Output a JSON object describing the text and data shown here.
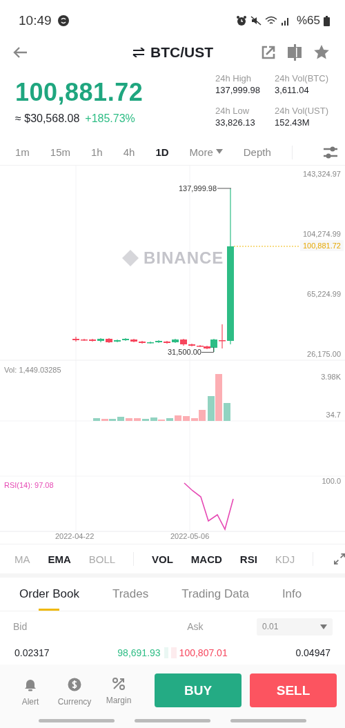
{
  "status_bar": {
    "time": "10:49",
    "battery": "%65"
  },
  "header": {
    "title": "BTC/UST"
  },
  "price": {
    "last": "100,881.72",
    "fiat": "≈ $30,568.08",
    "change": "+185.73%"
  },
  "stats": [
    {
      "label": "24h High",
      "value": "137,999.98"
    },
    {
      "label": "24h Vol(BTC)",
      "value": "3,611.04"
    },
    {
      "label": "24h Low",
      "value": "33,826.13"
    },
    {
      "label": "24h Vol(UST)",
      "value": "152.43M"
    }
  ],
  "intervals": [
    {
      "label": "1m",
      "selected": false
    },
    {
      "label": "15m",
      "selected": false
    },
    {
      "label": "1h",
      "selected": false
    },
    {
      "label": "4h",
      "selected": false
    },
    {
      "label": "1D",
      "selected": true
    },
    {
      "label": "More",
      "selected": false,
      "kind": "menu"
    },
    {
      "label": "Depth",
      "selected": false
    }
  ],
  "chart": {
    "watermark": "BINANCE",
    "high_marker": "137,999.98",
    "low_marker": "31,500.00",
    "current_price": "100,881.72",
    "y_labels": [
      "143,324.97",
      "104,274.99",
      "65,224.99",
      "26,175.00"
    ]
  },
  "volume": {
    "label": "Vol: 1,449.03285",
    "y_labels": [
      "3.98K",
      "34.7"
    ]
  },
  "rsi": {
    "label": "RSI(14): 97.08",
    "y_label": "100.0"
  },
  "dates": [
    "2022-04-22",
    "2022-05-06"
  ],
  "indicator_groups": [
    [
      {
        "label": "MA",
        "on": false
      },
      {
        "label": "EMA",
        "on": true
      },
      {
        "label": "BOLL",
        "on": false
      }
    ],
    [
      {
        "label": "VOL",
        "on": true
      },
      {
        "label": "MACD",
        "on": true
      },
      {
        "label": "RSI",
        "on": true
      },
      {
        "label": "KDJ",
        "on": false
      }
    ]
  ],
  "tabs": [
    {
      "label": "Order Book",
      "selected": true
    },
    {
      "label": "Trades",
      "selected": false
    },
    {
      "label": "Trading Data",
      "selected": false
    },
    {
      "label": "Info",
      "selected": false
    }
  ],
  "order_book": {
    "bid_label": "Bid",
    "ask_label": "Ask",
    "precision": "0.01",
    "rows": [
      {
        "bid_amount": "0.02317",
        "bid_price": "98,691.93",
        "ask_price": "100,807.01",
        "ask_amount": "0.04947"
      }
    ]
  },
  "actions": [
    {
      "label": "Alert",
      "kind": "bell"
    },
    {
      "label": "Currency",
      "kind": "dollar"
    },
    {
      "label": "Margin",
      "kind": "percent"
    }
  ],
  "trade_buttons": [
    {
      "label": "BUY",
      "kind": "buy"
    },
    {
      "label": "SELL",
      "kind": "sell"
    }
  ]
}
